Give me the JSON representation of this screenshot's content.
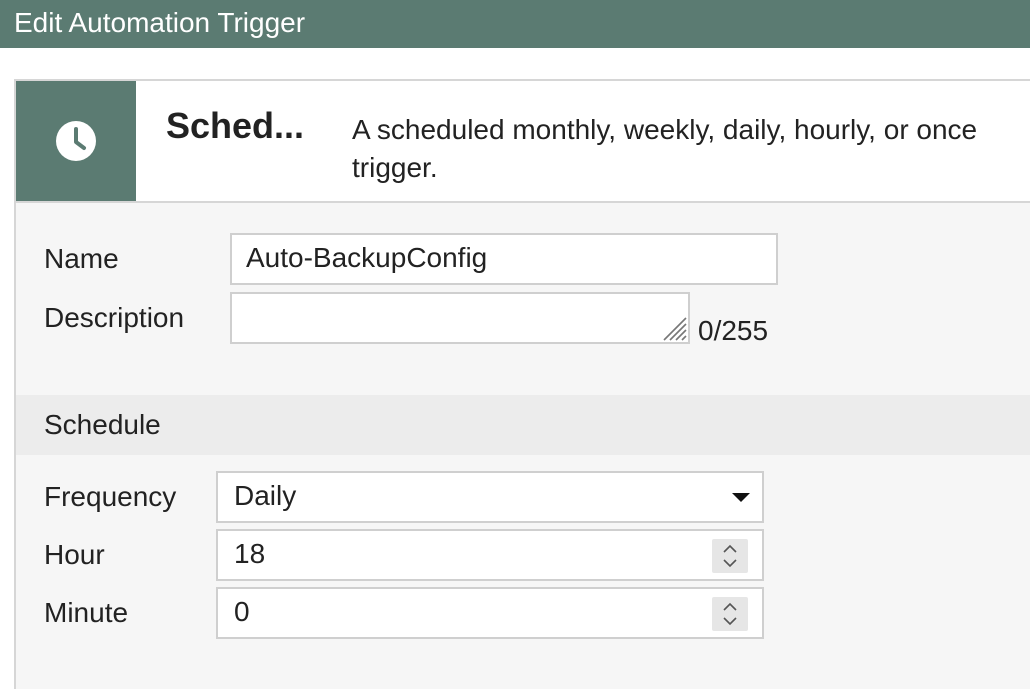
{
  "window": {
    "title": "Edit Automation Trigger"
  },
  "trigger": {
    "icon": "clock-icon",
    "name": "Sched...",
    "description": "A scheduled monthly, weekly, daily, hourly, or once trigger."
  },
  "form": {
    "name_label": "Name",
    "name_value": "Auto-BackupConfig",
    "description_label": "Description",
    "description_value": "",
    "description_counter": "0/255"
  },
  "schedule": {
    "section_title": "Schedule",
    "frequency_label": "Frequency",
    "frequency_value": "Daily",
    "hour_label": "Hour",
    "hour_value": "18",
    "minute_label": "Minute",
    "minute_value": "0"
  },
  "colors": {
    "accent": "#5b7b72",
    "panel_bg": "#f6f6f6",
    "section_bg": "#ececec"
  }
}
